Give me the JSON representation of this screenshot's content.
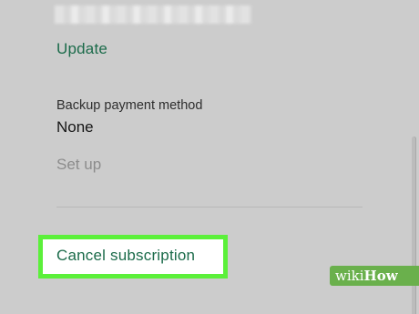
{
  "account": {
    "update_label": "Update"
  },
  "backup_payment": {
    "label": "Backup payment method",
    "value": "None",
    "setup_label": "Set up"
  },
  "subscription": {
    "cancel_label": "Cancel subscription"
  },
  "watermark": {
    "prefix": "wiki",
    "suffix": "How"
  },
  "colors": {
    "link_green": "#1b6b4a",
    "highlight_green": "#5bf03a",
    "muted_text": "#8c8c8c",
    "watermark_green": "#6ab04c"
  }
}
